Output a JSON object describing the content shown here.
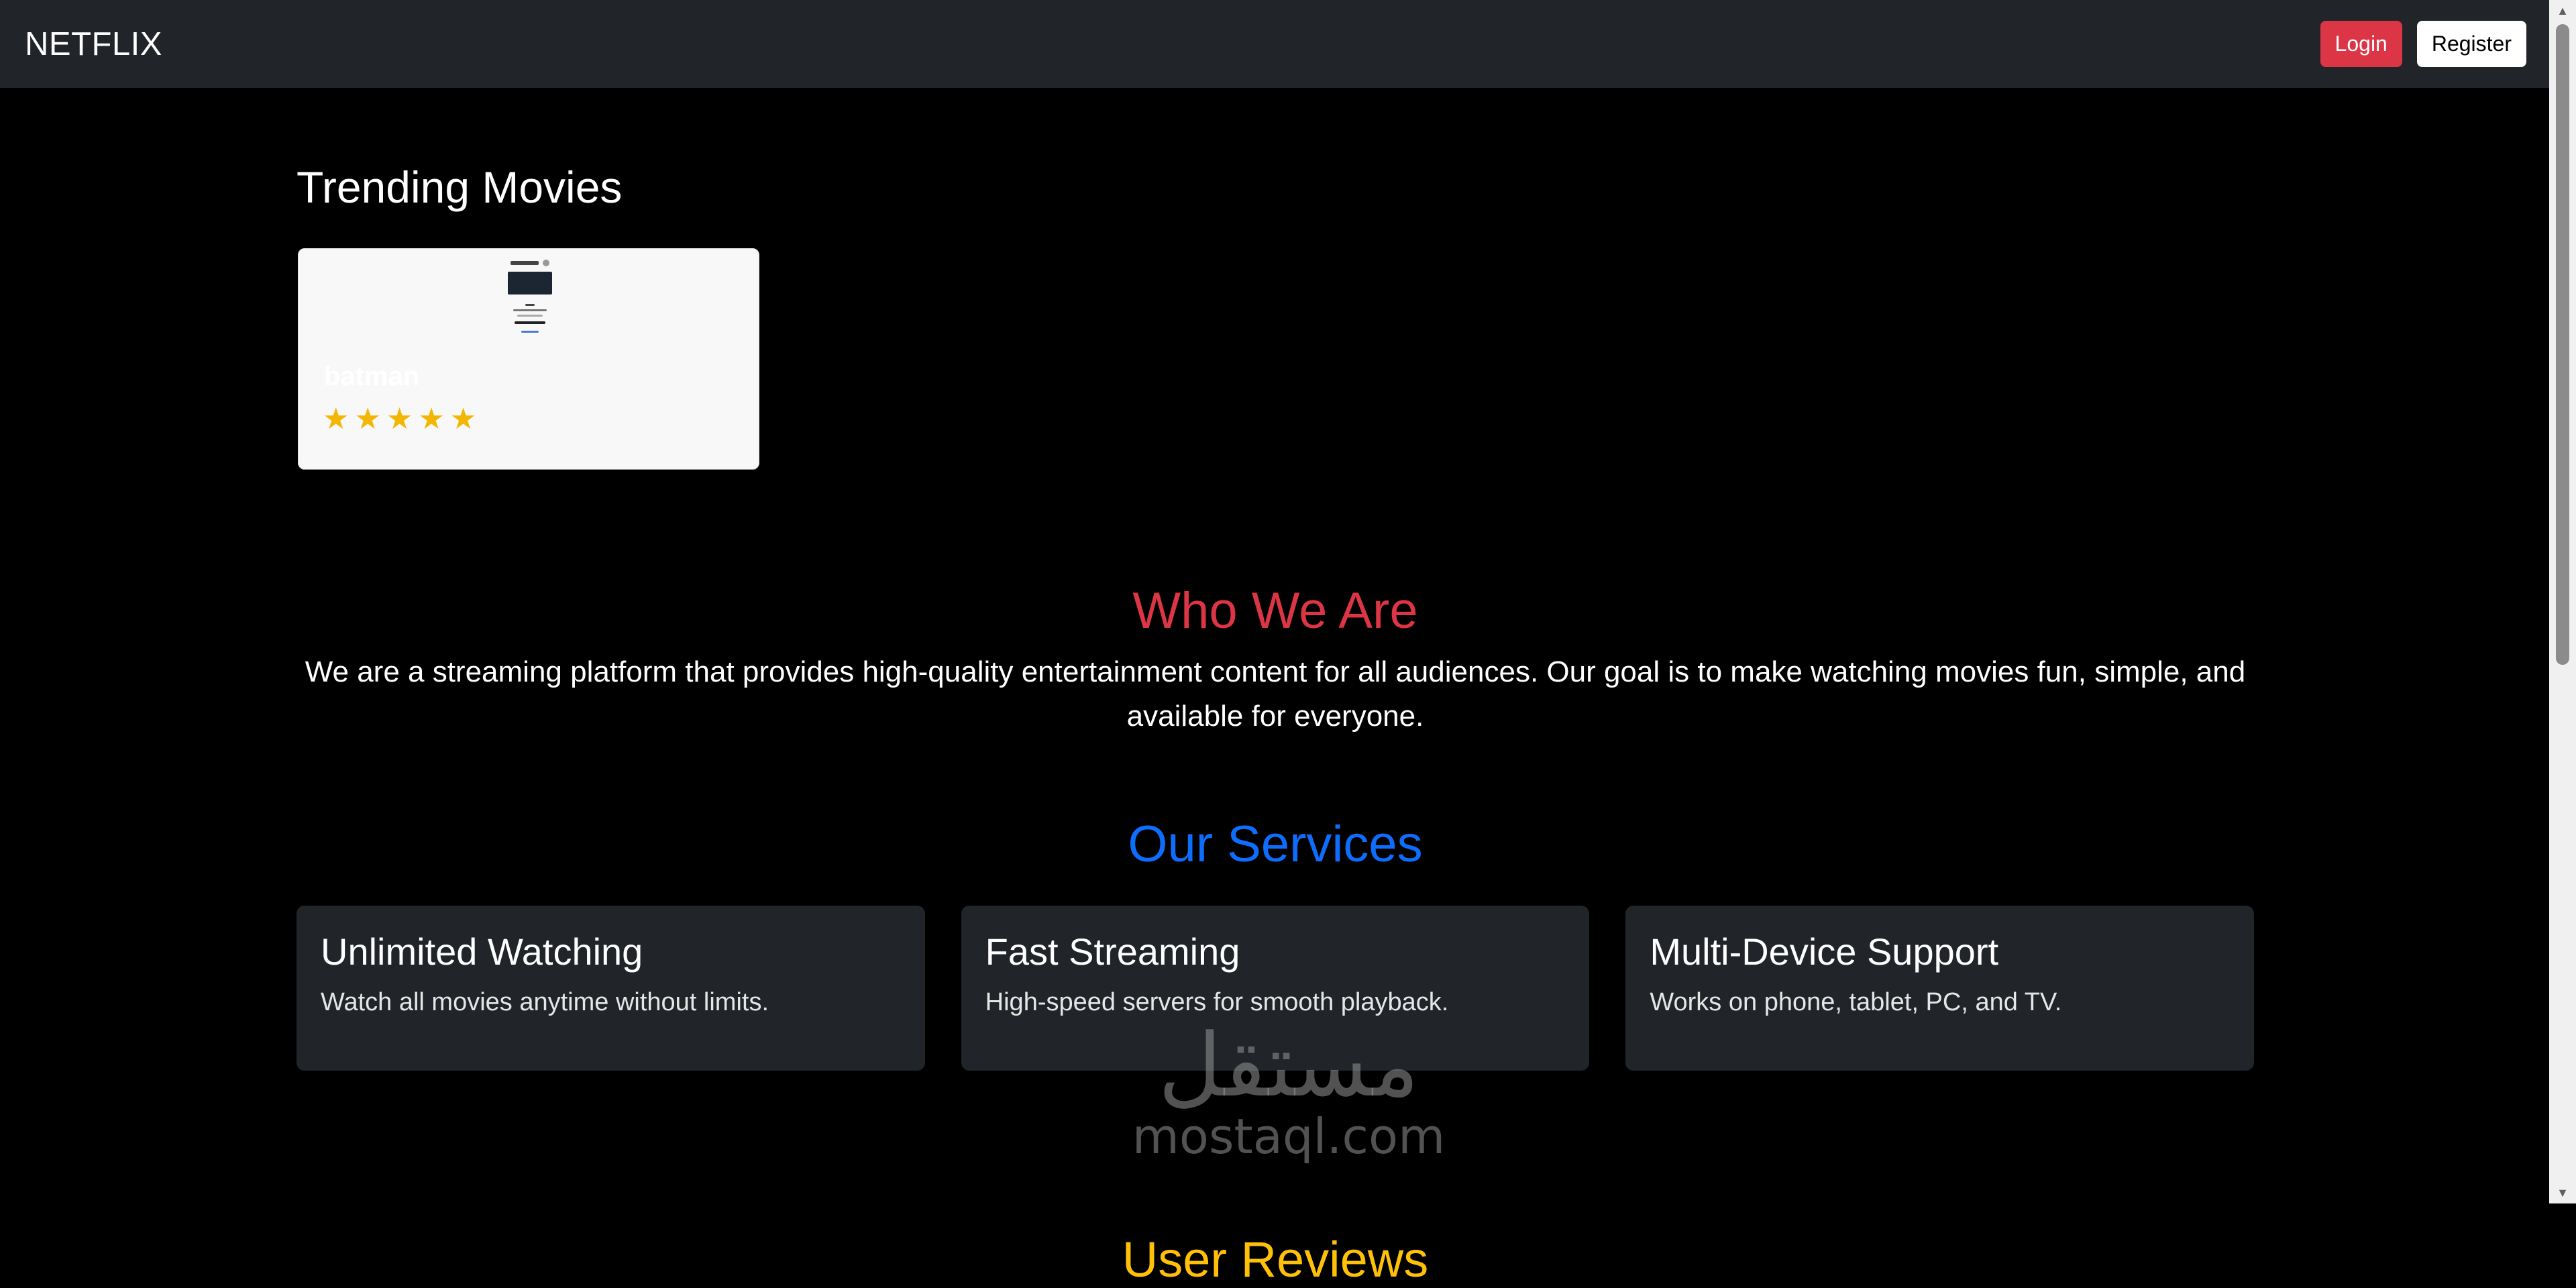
{
  "navbar": {
    "brand": "NETFLIX",
    "login_label": "Login",
    "register_label": "Register",
    "login_color": "#dc3545"
  },
  "trending": {
    "title": "Trending Movies",
    "movies": [
      {
        "title": "batman",
        "rating": 5,
        "max_rating": 5
      }
    ]
  },
  "who": {
    "title": "Who We Are",
    "title_color": "#dc3545",
    "text": "We are a streaming platform that provides high-quality entertainment content for all audiences. Our goal is to make watching movies fun, simple, and available for everyone."
  },
  "services": {
    "title": "Our Services",
    "title_color": "#0d6efd",
    "items": [
      {
        "title": "Unlimited Watching",
        "description": "Watch all movies anytime without limits."
      },
      {
        "title": "Fast Streaming",
        "description": "High-speed servers for smooth playback."
      },
      {
        "title": "Multi-Device Support",
        "description": "Works on phone, tablet, PC, and TV."
      }
    ]
  },
  "reviews": {
    "title": "User Reviews",
    "title_color": "#ffc107"
  },
  "watermark": {
    "arabic": "مستقل",
    "latin": "mostaql.com"
  },
  "icons": {
    "star": "star-icon",
    "scroll_up": "scroll-up-arrow-icon",
    "scroll_down": "scroll-down-arrow-icon"
  }
}
